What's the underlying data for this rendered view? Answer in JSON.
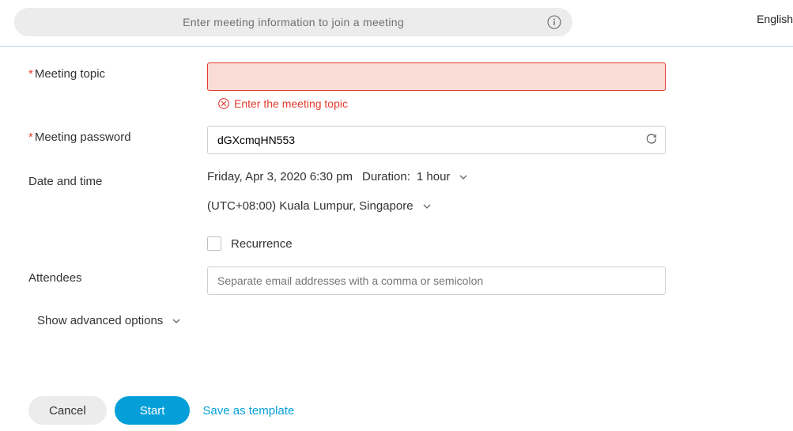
{
  "top": {
    "search_placeholder": "Enter meeting information to join a meeting",
    "language": "English"
  },
  "form": {
    "topic": {
      "label": "Meeting topic",
      "value": "",
      "error": "Enter the meeting topic"
    },
    "password": {
      "label": "Meeting password",
      "value": "dGXcmqHN553"
    },
    "datetime": {
      "label": "Date and time",
      "value": "Friday, Apr 3, 2020 6:30 pm",
      "duration_label": "Duration:",
      "duration_value": "1 hour",
      "timezone": "(UTC+08:00) Kuala Lumpur, Singapore",
      "recurrence_label": "Recurrence"
    },
    "attendees": {
      "label": "Attendees",
      "placeholder": "Separate email addresses with a comma or semicolon"
    },
    "advanced": "Show advanced options"
  },
  "actions": {
    "cancel": "Cancel",
    "start": "Start",
    "save_template": "Save as template"
  }
}
